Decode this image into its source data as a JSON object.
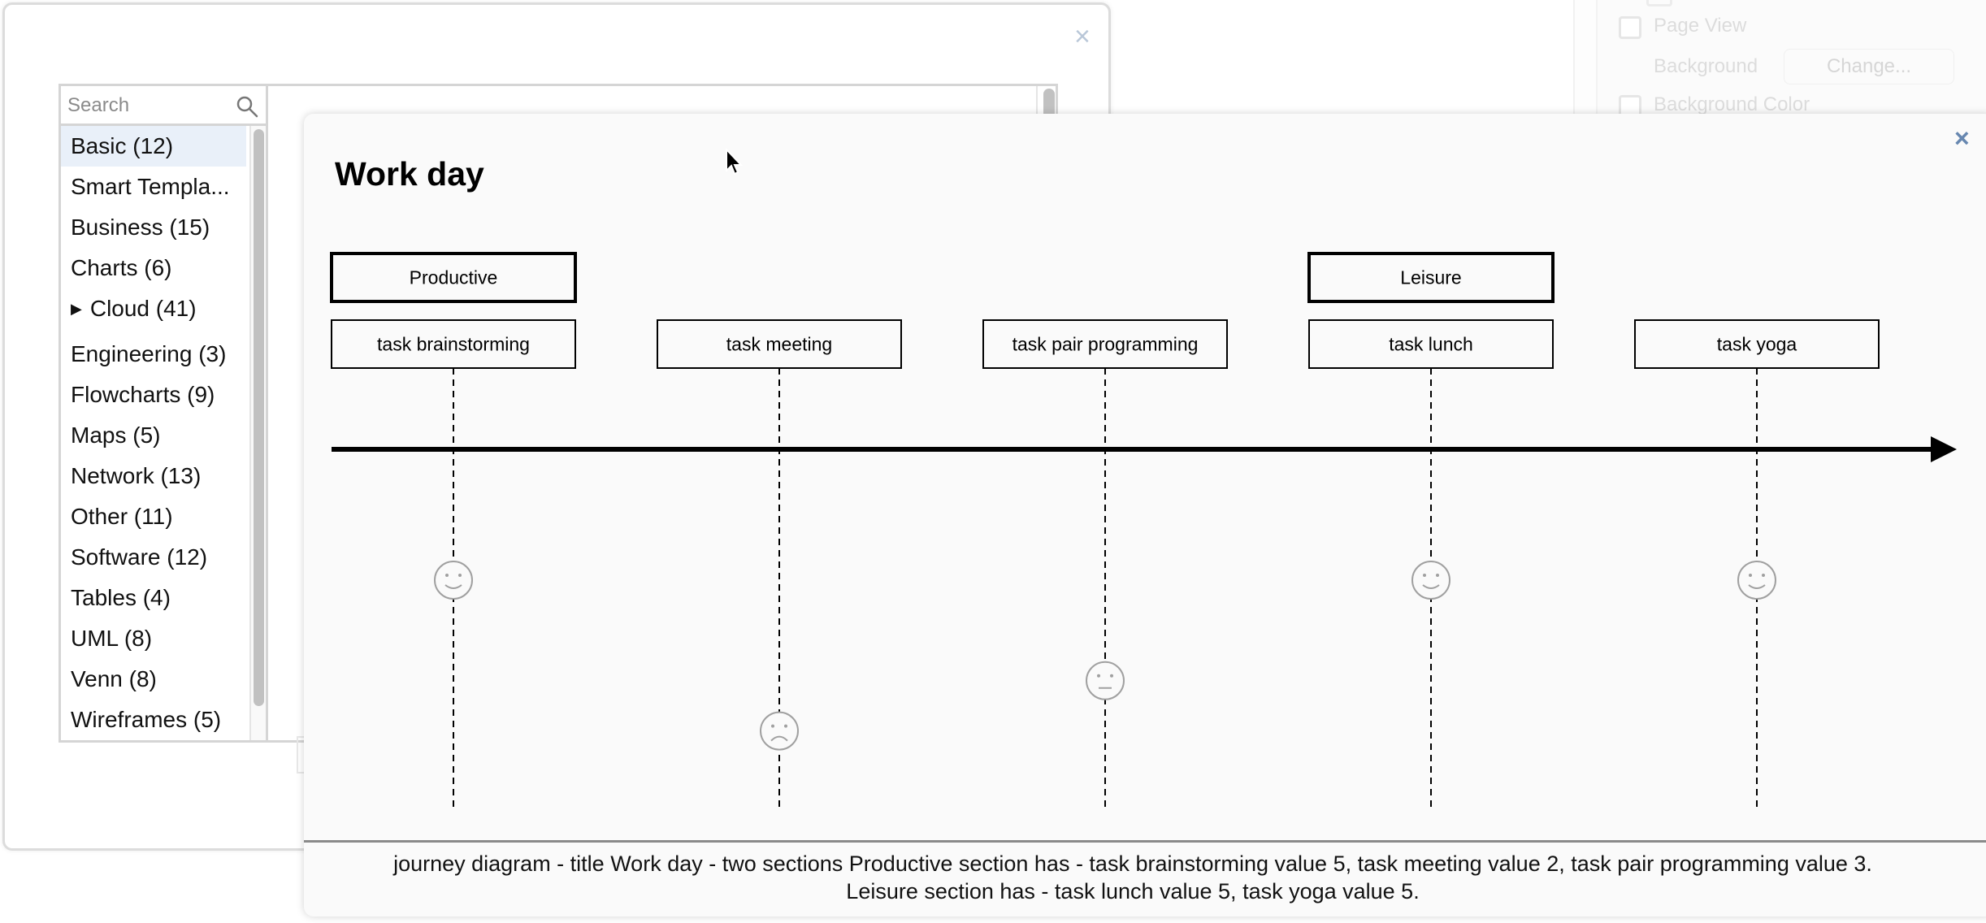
{
  "format_panel": {
    "page_view_label": "Page View",
    "background_label": "Background",
    "change_button": "Change...",
    "background_color_label": "Background Color"
  },
  "template_dialog": {
    "close_label": "×",
    "search": {
      "placeholder": "Search",
      "value": ""
    },
    "categories": [
      {
        "label": "Basic (12)",
        "selected": true
      },
      {
        "label": "Smart Templa..."
      },
      {
        "label": "Business (15)"
      },
      {
        "label": "Charts (6)"
      },
      {
        "label": "Cloud (41)",
        "expandable": true
      },
      {
        "label": "Engineering (3)"
      },
      {
        "label": "Flowcharts (9)"
      },
      {
        "label": "Maps (5)"
      },
      {
        "label": "Network (13)"
      },
      {
        "label": "Other (11)"
      },
      {
        "label": "Software (12)"
      },
      {
        "label": "Tables (4)"
      },
      {
        "label": "UML (8)"
      },
      {
        "label": "Venn (8)"
      },
      {
        "label": "Wireframes (5)"
      }
    ],
    "expand_glyph": "▶"
  },
  "preview_dialog": {
    "close_label": "×",
    "caption_line1": "journey diagram - title Work day - two sections Productive section has - task brainstorming value 5, task meeting value 2, task pair programming value 3.",
    "caption_line2": "Leisure section has - task lunch value 5, task yoga value 5."
  },
  "chart_data": {
    "type": "journey",
    "title": "Work day",
    "sections": [
      {
        "name": "Productive",
        "tasks": [
          "task brainstorming",
          "task meeting",
          "task pair programming"
        ]
      },
      {
        "name": "Leisure",
        "tasks": [
          "task lunch",
          "task yoga"
        ]
      }
    ],
    "tasks": [
      {
        "label": "task brainstorming",
        "section": "Productive",
        "score": 5
      },
      {
        "label": "task meeting",
        "section": "Productive",
        "score": 2
      },
      {
        "label": "task pair programming",
        "section": "Productive",
        "score": 3
      },
      {
        "label": "task lunch",
        "section": "Leisure",
        "score": 5
      },
      {
        "label": "task yoga",
        "section": "Leisure",
        "score": 5
      }
    ],
    "score_range": [
      1,
      5
    ],
    "colors": {
      "stroke": "#000000",
      "face": "#a0a0a0",
      "background": "#fafafa"
    }
  }
}
